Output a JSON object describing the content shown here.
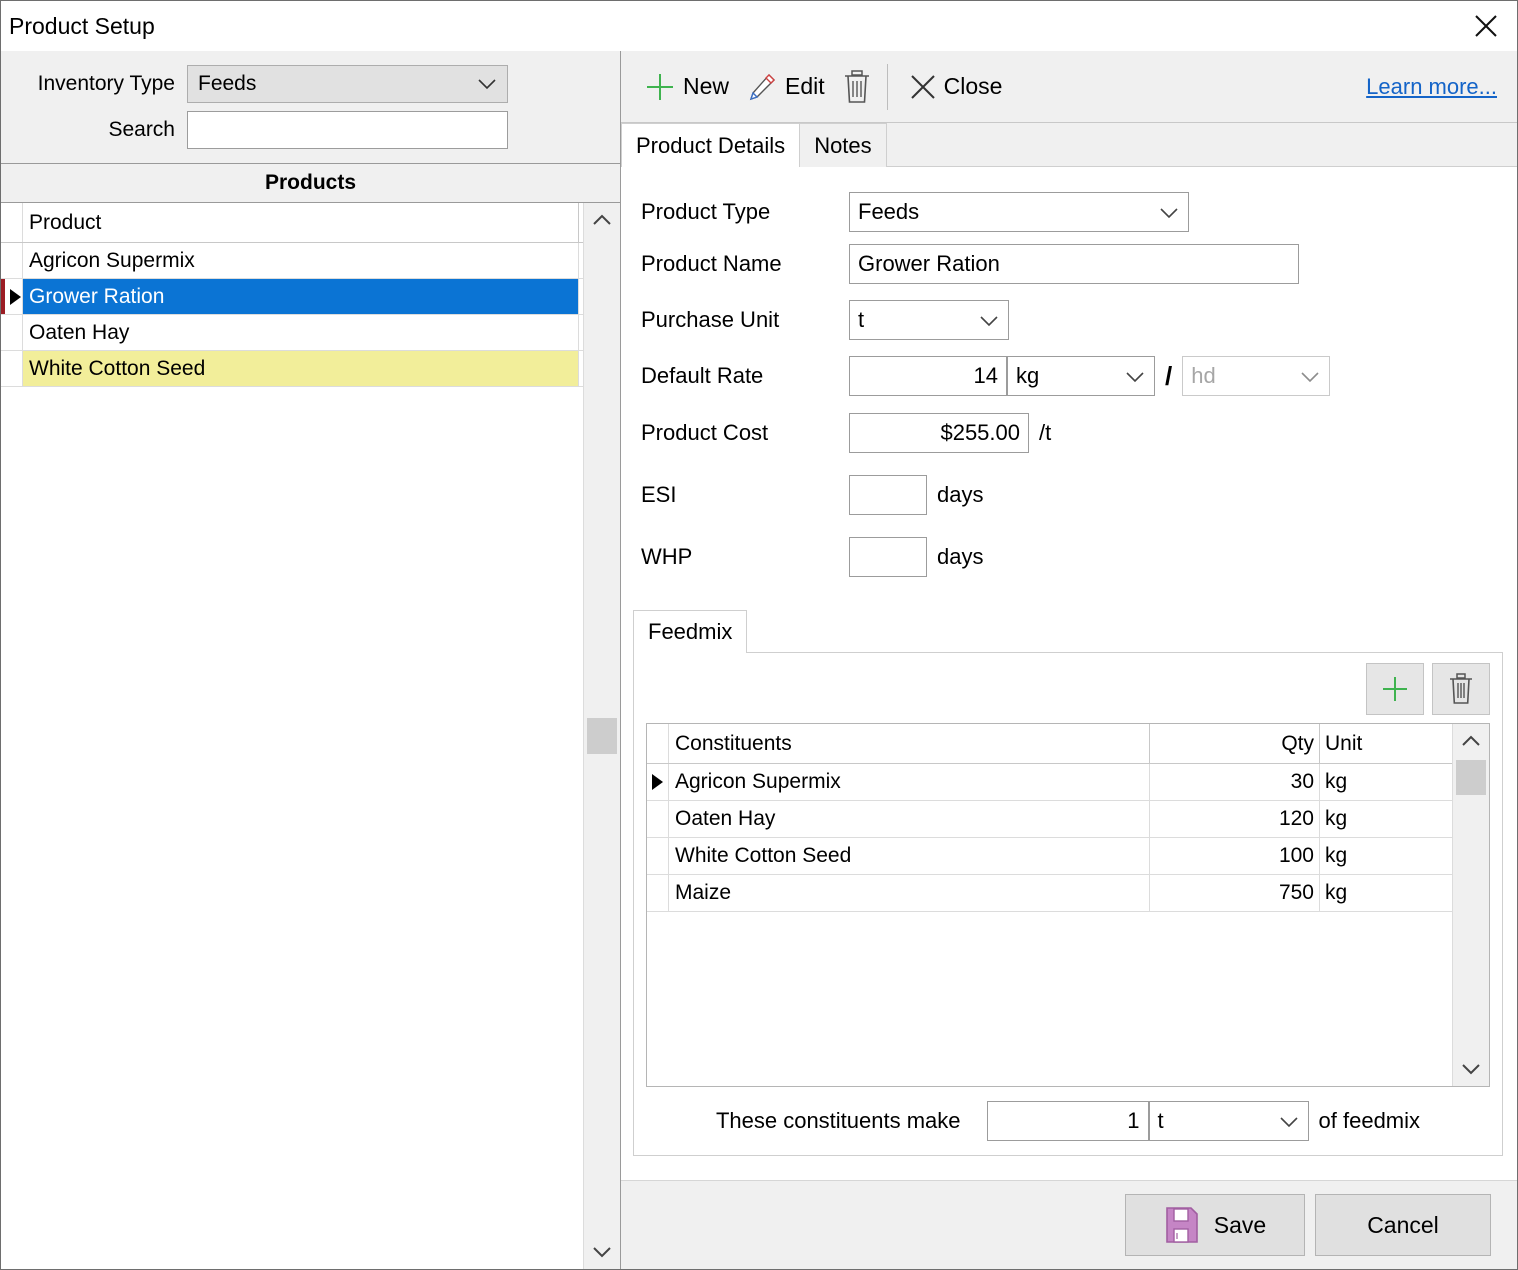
{
  "window": {
    "title": "Product Setup",
    "close_icon": "close-icon"
  },
  "left": {
    "inventory_type_label": "Inventory Type",
    "inventory_type_value": "Feeds",
    "search_label": "Search",
    "search_value": "",
    "search_placeholder": "",
    "products_header": "Products",
    "column_header": "Product",
    "rows": [
      {
        "name": "Agricon Supermix",
        "state": "normal"
      },
      {
        "name": "Grower Ration",
        "state": "selected"
      },
      {
        "name": "Oaten Hay",
        "state": "normal"
      },
      {
        "name": "White Cotton Seed",
        "state": "marked"
      }
    ]
  },
  "toolbar": {
    "new_label": "New",
    "edit_label": "Edit",
    "delete_icon": "trash-icon",
    "close_label": "Close",
    "learn_more_label": "Learn more..."
  },
  "tabs": [
    {
      "label": "Product Details",
      "active": true
    },
    {
      "label": "Notes",
      "active": false
    }
  ],
  "details": {
    "product_type_label": "Product Type",
    "product_type_value": "Feeds",
    "product_name_label": "Product Name",
    "product_name_value": "Grower Ration",
    "purchase_unit_label": "Purchase Unit",
    "purchase_unit_value": "t",
    "default_rate_label": "Default Rate",
    "default_rate_value": "14",
    "default_rate_unit": "kg",
    "default_rate_separator": "/",
    "default_rate_per": "hd",
    "product_cost_label": "Product Cost",
    "product_cost_value": "$255.00",
    "product_cost_suffix": "/t",
    "esi_label": "ESI",
    "esi_value": "",
    "esi_suffix": "days",
    "whp_label": "WHP",
    "whp_value": "",
    "whp_suffix": "days"
  },
  "feedmix": {
    "tab_label": "Feedmix",
    "add_icon": "plus-icon",
    "delete_icon": "trash-icon",
    "columns": [
      "Constituents",
      "Qty",
      "Unit"
    ],
    "rows": [
      {
        "name": "Agricon Supermix",
        "qty": "30",
        "unit": "kg",
        "current": true
      },
      {
        "name": "Oaten Hay",
        "qty": "120",
        "unit": "kg",
        "current": false
      },
      {
        "name": "White Cotton Seed",
        "qty": "100",
        "unit": "kg",
        "current": false
      },
      {
        "name": "Maize",
        "qty": "750",
        "unit": "kg",
        "current": false
      }
    ],
    "footer_prefix": "These constituents make",
    "footer_qty": "1",
    "footer_unit": "t",
    "footer_suffix": "of feedmix"
  },
  "buttons": {
    "save_label": "Save",
    "save_icon": "floppy-disk-icon",
    "cancel_label": "Cancel"
  },
  "colors": {
    "selection_blue": "#0b74d4",
    "marked_yellow": "#f2ee9a",
    "link_blue": "#1464c8",
    "accent_green": "#3fb34f",
    "save_purple": "#c585c5",
    "row_marker_red": "#9b1c23"
  }
}
